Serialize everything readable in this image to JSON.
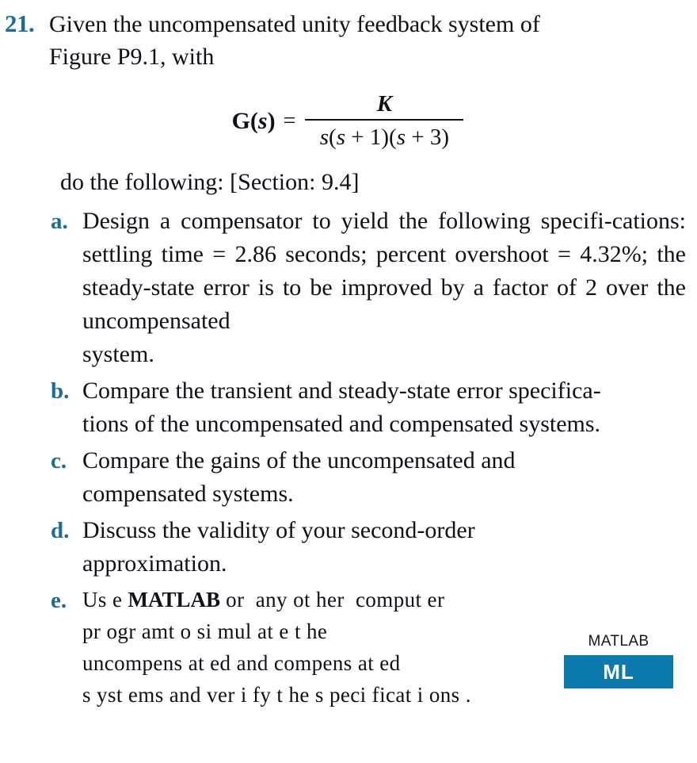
{
  "problem": {
    "number": "21.",
    "number_color": "#1a6d99",
    "intro_main": "Given the uncompensated unity feedback system of",
    "intro_last": "Figure P9.1, with",
    "do_following": "do the following: [Section: 9.4]"
  },
  "equation": {
    "lhs_G": "G",
    "lhs_open": "(",
    "lhs_s": "s",
    "lhs_close": ")",
    "equals": "=",
    "numerator": "K",
    "denominator_parts": {
      "s1": "s",
      "p1_open": "(",
      "s2": "s",
      "plus1": " + 1",
      "p1_close": ")",
      "p2_open": "(",
      "s3": "s",
      "plus3": " + 3",
      "p2_close": ")"
    },
    "denominator_plain": "s(s + 1)(s + 3)"
  },
  "sub_items": [
    {
      "letter": "a.",
      "text_main": "Design a compensator to yield the following specifi-cations: settling time = 2.86 seconds; percent overshoot = 4.32%; the steady-state error is to be improved by a factor of 2 over the uncompensated",
      "text_last": "system.",
      "lines": [
        "Design a compensator to yield the following specifi-",
        "cations:  settling  time = 2.86  seconds;  percent",
        "overshoot = 4.32%; the steady-state error is to be",
        "improved by a factor of 2 over the uncompensated",
        "system."
      ]
    },
    {
      "letter": "b.",
      "text_main": "Compare the transient and steady-state error specifica-",
      "text_last": "tions of the uncompensated and compensated systems.",
      "lines": [
        "Compare the transient and steady-state error specifica-",
        "tions of the uncompensated and compensated systems."
      ]
    },
    {
      "letter": "c.",
      "text_main": "Compare the gains of the uncompensated and",
      "text_last": "compensated systems.",
      "lines": [
        "Compare  the  gains  of  the  uncompensated  and",
        "compensated systems."
      ]
    },
    {
      "letter": "d.",
      "text_main": "Discuss the validity of your second-order",
      "text_last": "approximation.",
      "lines": [
        "Discuss   the   validity   of   your   second-order",
        "approximation."
      ]
    }
  ],
  "item_e": {
    "letter": "e.",
    "line1_pre": "Us e ",
    "line1_bold": "MATLAB",
    "line1_post": " or  any ot her  comput er",
    "line2": "pr ogr amt o si mul at e t he",
    "line3": "uncompens at ed and compens at ed",
    "line4": "s yst ems and ver i fy t he s peci ficat i ons ."
  },
  "matlab_badge": {
    "caption": "MATLAB",
    "box_label": "ML",
    "box_color": "#0d7aad",
    "label_color": "#ffffff"
  }
}
